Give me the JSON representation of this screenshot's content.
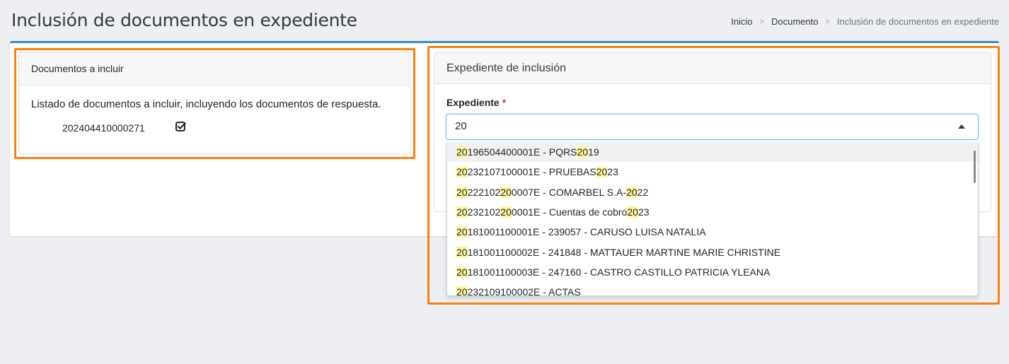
{
  "page": {
    "title": "Inclusión de documentos en expediente"
  },
  "breadcrumb": {
    "items": [
      "Inicio",
      "Documento"
    ],
    "current": "Inclusión de documentos en expediente",
    "separator": ">"
  },
  "left_panel": {
    "title": "Documentos a incluir",
    "description": "Listado de documentos a incluir, incluyendo los documentos de respuesta.",
    "document_number": "202404410000271",
    "document_icon": "check-square-icon"
  },
  "right_panel": {
    "title": "Expediente de inclusión",
    "field_label": "Expediente",
    "required_mark": "*",
    "input_value": "20",
    "caret_icon": "caret-up-icon"
  },
  "dropdown_options": [
    "20196504400001E - PQRS 2019",
    "20232107100001E - PRUEBAS 2023",
    "20222102200007E - COMARBEL S.A- 2022",
    "20232102200001E - Cuentas de cobro 2023",
    "20181001100001E - 239057 - CARUSO LUISA NATALIA",
    "20181001100002E - 241848 - MATTAUER MARTINE MARIE CHRISTINE",
    "20181001100003E - 247160 - CASTRO CASTILLO PATRICIA YLEANA",
    "20232109100002E - ACTAS"
  ],
  "colors": {
    "accent": "#3c8dbc",
    "highlight_box": "#ff7f0e",
    "match_highlight": "#fff59a",
    "required": "#dc3545"
  }
}
